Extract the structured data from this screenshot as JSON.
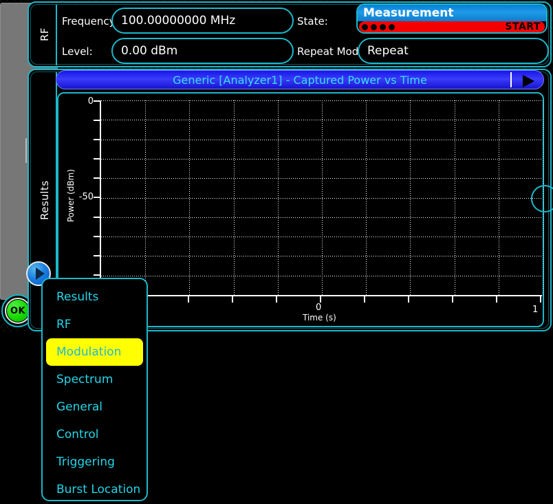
{
  "rf_panel": {
    "tab_label": "RF",
    "frequency_label": "Frequency:",
    "frequency_value": "100.00000000 MHz",
    "level_label": "Level:",
    "level_value": "0.00 dBm",
    "state_label": "State:",
    "repeat_mode_label": "Repeat Mode:",
    "repeat_mode_value": "Repeat"
  },
  "measurement": {
    "title": "Measurement",
    "start_label": "START",
    "dots": 4,
    "bar_color": "#f50000",
    "title_color": "#1e9ae8"
  },
  "results_panel": {
    "tab_label": "Results",
    "graph_title": "Generic [Analyzer1] -  Captured Power vs Time",
    "play_icon": "play-triangle-icon"
  },
  "chart_data": {
    "type": "line",
    "title": "Generic [Analyzer1] -  Captured Power vs Time",
    "xlabel": "Time (s)",
    "ylabel": "Power (dBm)",
    "xlim": [
      -0.72,
      1.0
    ],
    "ylim": [
      -100,
      0
    ],
    "x_tick_labels": [
      "0",
      "1"
    ],
    "y_tick_labels": [
      "0",
      "-50"
    ],
    "x_major_count": 10,
    "y_major_count": 10,
    "grid": true,
    "series": [],
    "note": "empty trace - no data captured"
  },
  "menu": {
    "items": [
      {
        "label": "Results",
        "selected": false
      },
      {
        "label": "RF",
        "selected": false
      },
      {
        "label": "Modulation",
        "selected": true
      },
      {
        "label": "Spectrum",
        "selected": false
      },
      {
        "label": "General",
        "selected": false
      },
      {
        "label": "Control",
        "selected": false
      },
      {
        "label": "Triggering",
        "selected": false
      },
      {
        "label": "Burst Location",
        "selected": false
      }
    ],
    "highlight_color": "#ffff00"
  },
  "chrome": {
    "ok_label": "OK",
    "accent_color": "#1ab9cc"
  }
}
